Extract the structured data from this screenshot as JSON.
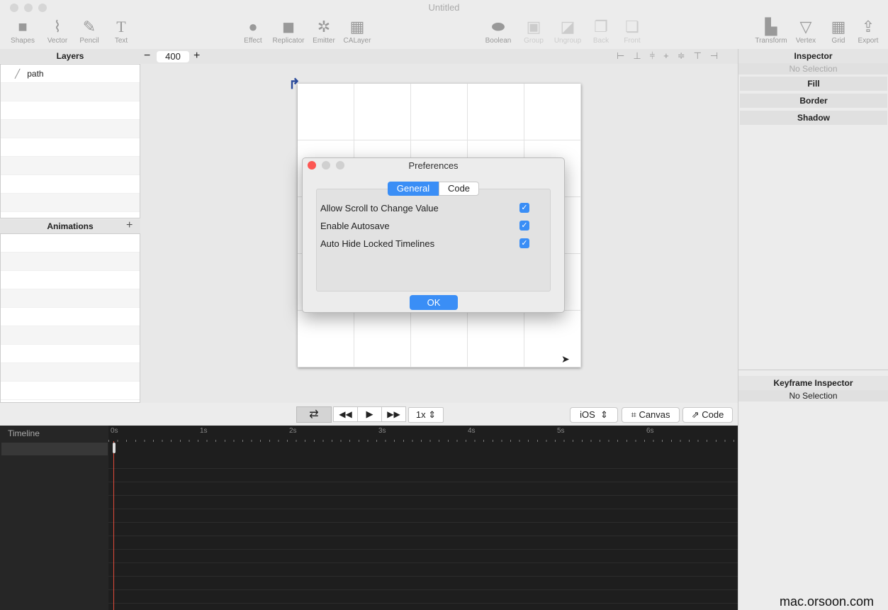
{
  "window": {
    "title": "Untitled"
  },
  "toolbar": {
    "left": [
      "Shapes",
      "Vector",
      "Pencil",
      "Text"
    ],
    "middle": [
      "Effect",
      "Replicator",
      "Emitter",
      "CALayer"
    ],
    "arrange": [
      "Boolean",
      "Group",
      "Ungroup",
      "Back",
      "Front"
    ],
    "right": [
      "Transform",
      "Vertex",
      "Grid",
      "Export"
    ]
  },
  "zoom": {
    "value": "400",
    "minus": "−",
    "plus": "+"
  },
  "layers": {
    "title": "Layers",
    "items": [
      "path"
    ]
  },
  "animations": {
    "title": "Animations",
    "add": "+"
  },
  "inspector": {
    "title": "Inspector",
    "status": "No Selection",
    "sections": [
      "Fill",
      "Border",
      "Shadow"
    ]
  },
  "keyframe": {
    "title": "Keyframe Inspector",
    "status": "No Selection"
  },
  "playback": {
    "speed": "1x",
    "platform": "iOS",
    "canvas": "Canvas",
    "code": "Code"
  },
  "timeline": {
    "label": "Timeline",
    "ticks": [
      "0s",
      "1s",
      "2s",
      "3s",
      "4s",
      "5s",
      "6s"
    ]
  },
  "preferences": {
    "title": "Preferences",
    "tabs": [
      "General",
      "Code"
    ],
    "options": [
      {
        "label": "Allow Scroll to Change Value",
        "checked": true
      },
      {
        "label": "Enable Autosave",
        "checked": true
      },
      {
        "label": "Auto Hide Locked Timelines",
        "checked": true
      }
    ],
    "ok": "OK"
  },
  "watermark": {
    "text": "mac.orsoon.com"
  }
}
